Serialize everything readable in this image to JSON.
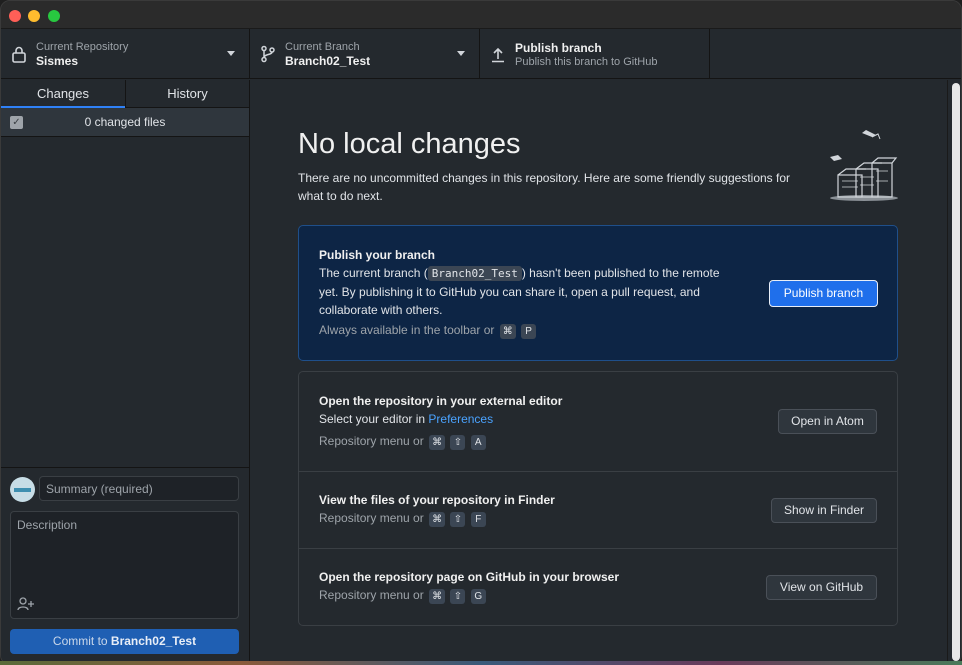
{
  "toolbar": {
    "repo": {
      "title": "Current Repository",
      "value": "Sismes"
    },
    "branch": {
      "title": "Current Branch",
      "value": "Branch02_Test"
    },
    "publish": {
      "title": "Publish branch",
      "subtitle": "Publish this branch to GitHub"
    }
  },
  "sidebar": {
    "tabs": [
      {
        "label": "Changes"
      },
      {
        "label": "History"
      }
    ],
    "changed_files_label": "0 changed files",
    "summary_placeholder": "Summary (required)",
    "description_placeholder": "Description",
    "commit_prefix": "Commit to ",
    "commit_branch": "Branch02_Test"
  },
  "main": {
    "heading": "No local changes",
    "subtext": "There are no uncommitted changes in this repository. Here are some friendly suggestions for what to do next.",
    "publish_card": {
      "title": "Publish your branch",
      "text_before": "The current branch (",
      "branch": "Branch02_Test",
      "text_after": ") hasn't been published to the remote",
      "text_line2": "yet. By publishing it to GitHub you can share it, open a pull request, and",
      "text_line3": "collaborate with others.",
      "hint": "Always available in the toolbar or",
      "keys": [
        "⌘",
        "P"
      ],
      "button": "Publish branch"
    },
    "actions": [
      {
        "title": "Open the repository in your external editor",
        "text": "Select your editor in ",
        "link": "Preferences",
        "hint": "Repository menu or",
        "keys": [
          "⌘",
          "⇧",
          "A"
        ],
        "button": "Open in Atom"
      },
      {
        "title": "View the files of your repository in Finder",
        "hint": "Repository menu or",
        "keys": [
          "⌘",
          "⇧",
          "F"
        ],
        "button": "Show in Finder"
      },
      {
        "title": "Open the repository page on GitHub in your browser",
        "hint": "Repository menu or",
        "keys": [
          "⌘",
          "⇧",
          "G"
        ],
        "button": "View on GitHub"
      }
    ]
  },
  "colors": {
    "accent": "#1f6feb",
    "publish_card_bg": "#0d2545",
    "link": "#4aa3ff"
  }
}
